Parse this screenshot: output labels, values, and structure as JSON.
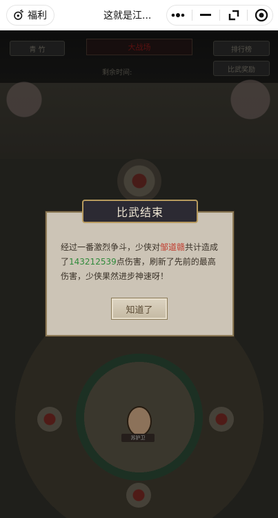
{
  "topbar": {
    "welfare_label": "福利",
    "title": "这就是江...",
    "capsule": {
      "more_icon": "more-dots-icon",
      "minimize_icon": "minimize-icon",
      "record_icon": "record-icon"
    }
  },
  "hud": {
    "left_button": "青 竹",
    "center_label": "大战场",
    "right_top_button": "排行榜",
    "right_bottom_button": "比武奖励",
    "timer_label": "剩余时间:",
    "timer_value": ""
  },
  "hero": {
    "name": "苏护卫"
  },
  "modal": {
    "title": "比武结束",
    "text_before_name": "经过一番激烈争斗，少侠对",
    "opponent": "邹道赣",
    "text_after_name": "共计造成了",
    "damage": "143212539",
    "text_after_damage": "点伤害，刷新了先前的最高伤害，少侠果然进步神速呀！",
    "ok_button": "知道了"
  },
  "colors": {
    "opponent": "#c0392b",
    "damage": "#2f8a3a",
    "modal_bg": "#ccc4b6",
    "header_bg": "#2c2a33"
  }
}
